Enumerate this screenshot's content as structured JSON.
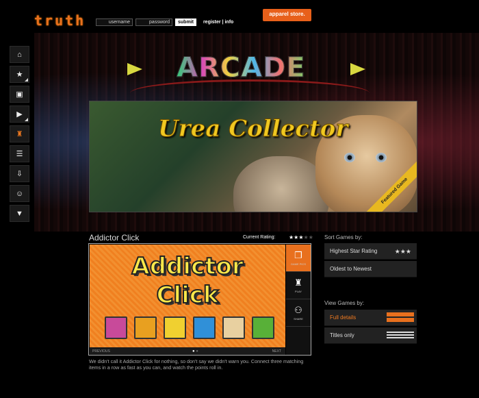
{
  "header": {
    "logo": "truth",
    "username_label": "username",
    "password_label": "password",
    "submit_label": "submit",
    "register_info": "register | info",
    "apparel_label": "apparel store."
  },
  "nav": {
    "items": [
      {
        "icon": "home-icon",
        "glyph": "⌂"
      },
      {
        "icon": "star-icon",
        "glyph": "★"
      },
      {
        "icon": "briefcase-icon",
        "glyph": "▣"
      },
      {
        "icon": "play-icon",
        "glyph": "▶"
      },
      {
        "icon": "arcade-icon",
        "glyph": "♜"
      },
      {
        "icon": "document-icon",
        "glyph": "☰"
      },
      {
        "icon": "download-icon",
        "glyph": "⇩"
      },
      {
        "icon": "people-icon",
        "glyph": "☺"
      },
      {
        "icon": "tshirt-icon",
        "glyph": "▼"
      }
    ]
  },
  "hero": {
    "sign_title": "ARCADE",
    "banner_title": "Urea Collector",
    "featured_label": "Featured Game"
  },
  "game": {
    "title": "Addictor Click",
    "rating_label": "Current Rating:",
    "rating": 3,
    "rating_max": 5,
    "art_line1": "Addictor",
    "art_line2": "Click",
    "prev_label": "PREVIOUS",
    "next_label": "NEXT",
    "side_buttons": [
      {
        "label": "GAME PICS",
        "icon": "pictures-icon",
        "glyph": "❐"
      },
      {
        "label": "PLAY",
        "icon": "joystick-icon",
        "glyph": "♜"
      },
      {
        "label": "SHARE",
        "icon": "share-icon",
        "glyph": "⚇"
      }
    ],
    "tiles": [
      {
        "icon": "cup-tile",
        "color": "#c84a9a"
      },
      {
        "icon": "carrot-tile",
        "color": "#e8a020"
      },
      {
        "icon": "shoe-tile",
        "color": "#f0d030"
      },
      {
        "icon": "dots-tile",
        "color": "#3090d8"
      },
      {
        "icon": "bread-tile",
        "color": "#e8d0a0"
      },
      {
        "icon": "frog-tile",
        "color": "#58b038"
      }
    ],
    "description": "We didn't call it Addictor Click for nothing, so don't say we didn't warn you. Connect three matching items in a row as fast as you can, and watch the points roll in."
  },
  "sort": {
    "header": "Sort Games by:",
    "options": [
      {
        "label": "Highest Star Rating",
        "stars": "★★★"
      },
      {
        "label": "Oldest to Newest"
      }
    ]
  },
  "view": {
    "header": "View Games by:",
    "options": [
      {
        "label": "Full details"
      },
      {
        "label": "Titles only"
      }
    ]
  },
  "colors": {
    "accent": "#e8701e",
    "background": "#000000"
  }
}
